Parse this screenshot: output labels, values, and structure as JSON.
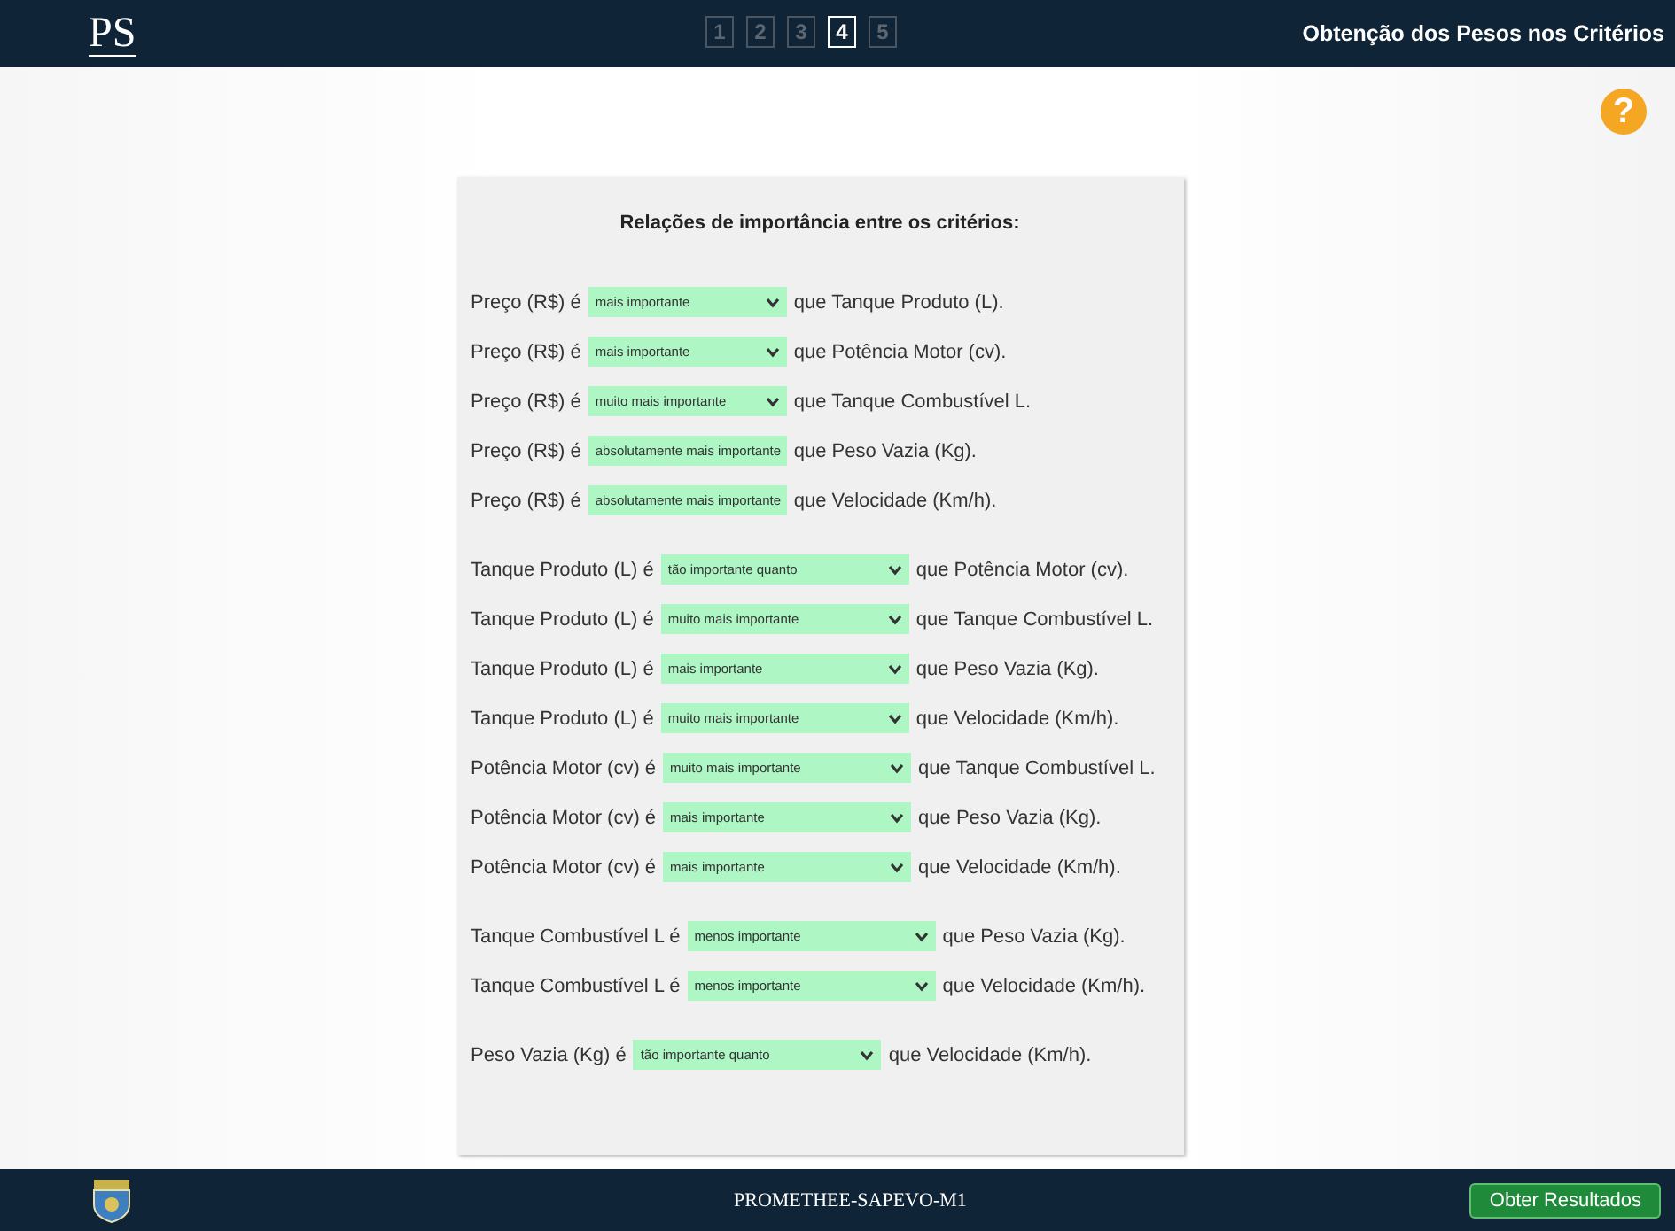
{
  "header": {
    "logo": "PS",
    "steps": [
      {
        "label": "1",
        "selected": false
      },
      {
        "label": "2",
        "selected": false
      },
      {
        "label": "3",
        "selected": false
      },
      {
        "label": "4",
        "selected": true
      },
      {
        "label": "5",
        "selected": false
      }
    ],
    "title": "Obtenção dos Pesos nos Critérios"
  },
  "help": "?",
  "panel": {
    "heading": "Relações de importância entre os critérios:",
    "groups": [
      {
        "rows": [
          {
            "left": "Preço (R$) é",
            "value": "mais importante",
            "right": "que Tanque Produto (L)."
          },
          {
            "left": "Preço (R$) é",
            "value": "mais importante",
            "right": "que Potência Motor (cv)."
          },
          {
            "left": "Preço (R$) é",
            "value": "muito mais importante",
            "right": "que Tanque Combustível L."
          },
          {
            "left": "Preço (R$) é",
            "value": "absolutamente mais importante",
            "right": "que Peso Vazia (Kg)."
          },
          {
            "left": "Preço (R$) é",
            "value": "absolutamente mais importante",
            "right": "que Velocidade (Km/h)."
          }
        ]
      },
      {
        "rows": [
          {
            "left": "Tanque Produto (L) é",
            "value": "tão importante quanto",
            "right": "que Potência Motor (cv)."
          },
          {
            "left": "Tanque Produto (L) é",
            "value": "muito mais importante",
            "right": "que Tanque Combustível L."
          },
          {
            "left": "Tanque Produto (L) é",
            "value": "mais importante",
            "right": "que Peso Vazia (Kg)."
          },
          {
            "left": "Tanque Produto (L) é",
            "value": "muito mais importante",
            "right": "que Velocidade (Km/h)."
          },
          {
            "left": "Potência Motor (cv) é",
            "value": "muito mais importante",
            "right": "que Tanque Combustível L."
          },
          {
            "left": "Potência Motor (cv) é",
            "value": "mais importante",
            "right": "que Peso Vazia (Kg)."
          },
          {
            "left": "Potência Motor (cv) é",
            "value": "mais importante",
            "right": "que Velocidade (Km/h)."
          }
        ]
      },
      {
        "rows": [
          {
            "left": "Tanque Combustível L é",
            "value": "menos importante",
            "right": "que Peso Vazia (Kg)."
          },
          {
            "left": "Tanque Combustível L é",
            "value": "menos importante",
            "right": "que Velocidade (Km/h)."
          }
        ]
      },
      {
        "rows": [
          {
            "left": "Peso Vazia (Kg) é",
            "value": "tão importante quanto",
            "right": "que Velocidade (Km/h)."
          }
        ]
      }
    ]
  },
  "footer": {
    "app_name": "PROMETHEE-SAPEVO-M1",
    "button": "Obter Resultados"
  }
}
